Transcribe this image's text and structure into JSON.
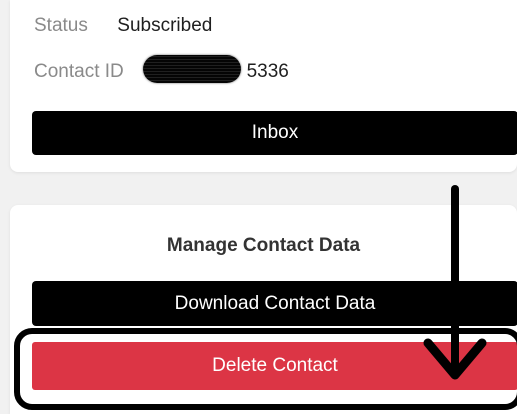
{
  "contact_info": {
    "status_label": "Status",
    "status_value": "Subscribed",
    "contact_id_label": "Contact ID",
    "contact_id_visible_suffix": "5336"
  },
  "actions": {
    "inbox_label": "Inbox"
  },
  "manage_section": {
    "title": "Manage Contact Data",
    "download_label": "Download Contact Data",
    "delete_label": "Delete Contact"
  },
  "colors": {
    "primary_button": "#000000",
    "danger_button": "#dc3545",
    "annotation": "#000000"
  },
  "annotations": {
    "arrow_icon": "arrow-down-icon",
    "highlight": "highlight-box"
  }
}
